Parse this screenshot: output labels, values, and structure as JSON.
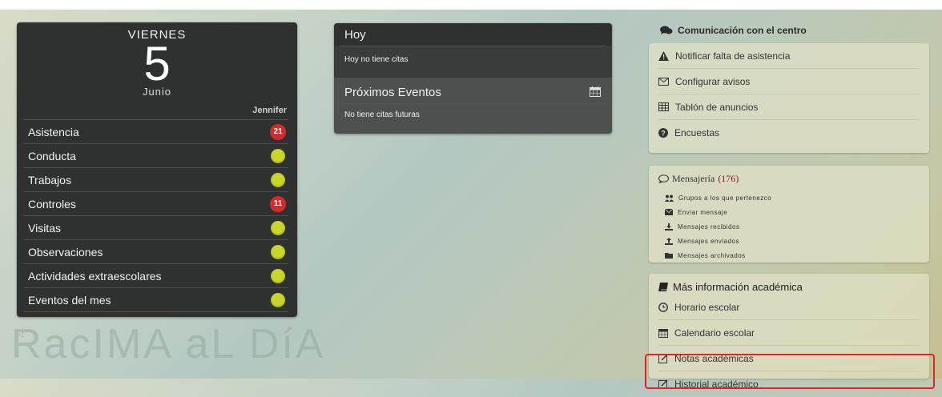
{
  "day_panel": {
    "weekday": "VIERNES",
    "day": "5",
    "month": "Junio",
    "student": "Jennifer",
    "rows": [
      {
        "label": "Asistencia",
        "badge": "21"
      },
      {
        "label": "Conducta",
        "badge": null
      },
      {
        "label": "Trabajos",
        "badge": null
      },
      {
        "label": "Controles",
        "badge": "11"
      },
      {
        "label": "Visitas",
        "badge": null
      },
      {
        "label": "Observaciones",
        "badge": null
      },
      {
        "label": "Actividades extraescolares",
        "badge": null
      },
      {
        "label": "Eventos del mes",
        "badge": null
      }
    ]
  },
  "logo_text": "RacIMA aL DíA",
  "agenda": {
    "today_title": "Hoy",
    "today_text": "Hoy no tiene citas",
    "upcoming_title": "Próximos Eventos",
    "upcoming_text": "No tiene citas futuras"
  },
  "communication": {
    "title": "Comunicación con el centro",
    "items": [
      {
        "label": "Notificar falta de asistencia",
        "icon": "warning-icon"
      },
      {
        "label": "Configurar avisos",
        "icon": "envelope-icon"
      },
      {
        "label": "Tablón de anuncios",
        "icon": "table-icon"
      },
      {
        "label": "Encuestas",
        "icon": "question-icon"
      }
    ]
  },
  "messaging": {
    "title": "Mensajería",
    "count": "(176)",
    "items": [
      {
        "label": "Grupos a los que pertenezco",
        "icon": "group-icon"
      },
      {
        "label": "Enviar mensaje",
        "icon": "envelope-icon"
      },
      {
        "label": "Mensajes recibidos",
        "icon": "inbox-icon"
      },
      {
        "label": "Mensajes enviados",
        "icon": "outbox-icon"
      },
      {
        "label": "Mensajes archivados",
        "icon": "folder-icon"
      }
    ]
  },
  "academic": {
    "title": "Más información académica",
    "items": [
      {
        "label": "Horario escolar",
        "icon": "clock-icon"
      },
      {
        "label": "Calendario escolar",
        "icon": "calendar-icon"
      },
      {
        "label": "Notas académicas",
        "icon": "edit-icon"
      },
      {
        "label": "Historial académico",
        "icon": "edit-icon"
      }
    ]
  },
  "colors": {
    "badge_red": "#d52a2a",
    "status_dot": "#c8d629",
    "highlight": "#e0242a"
  }
}
